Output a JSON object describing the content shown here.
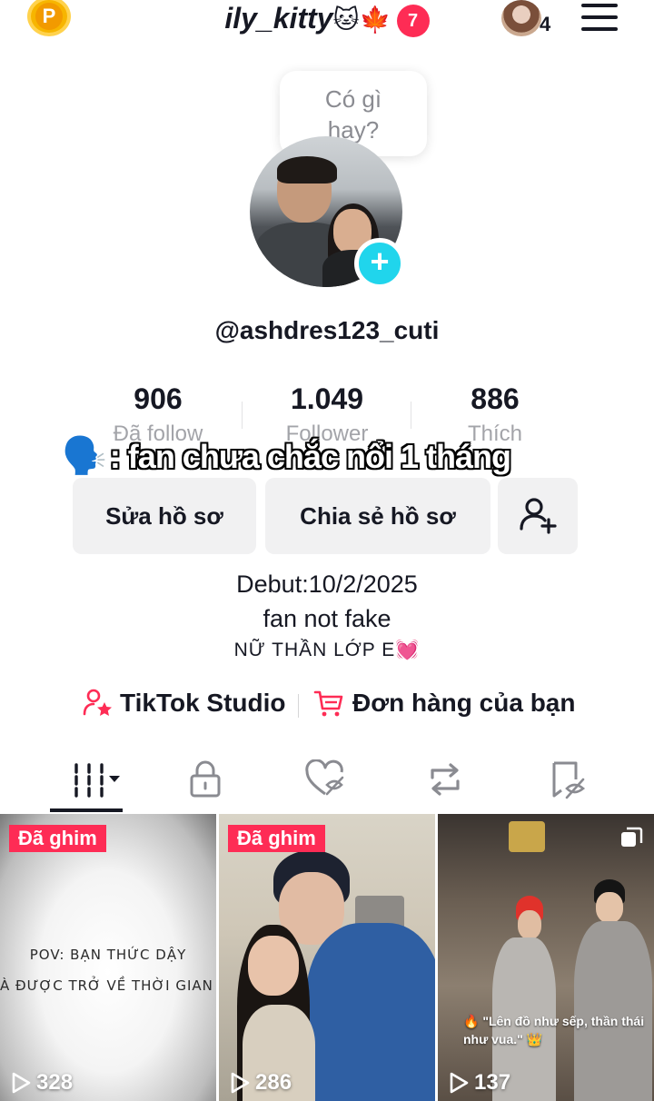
{
  "header": {
    "coin_letter": "P",
    "title": "ily_kitty",
    "title_emojis": "🐱🍁",
    "notification_count": "7",
    "account_switch_count": "4"
  },
  "profile": {
    "bubble_text_line1": "Có gì",
    "bubble_text_line2": "hay?",
    "handle": "@ashdres123_cuti",
    "stats": {
      "following_value": "906",
      "following_label": "Đã follow",
      "followers_value": "1.049",
      "followers_label": "Follower",
      "likes_value": "886",
      "likes_label": "Thích"
    },
    "overlay_caption": ": fan chưa chắc nổi 1 tháng",
    "overlay_emoji": "🗣️"
  },
  "actions": {
    "edit_profile": "Sửa hồ sơ",
    "share_profile": "Chia sẻ hồ sơ"
  },
  "bio": {
    "line1": "Debut:10/2/2025",
    "line2": "fan not fake",
    "line3": "NỮ THẦN LỚP E",
    "line3_emoji": "💓"
  },
  "links": {
    "studio": "TikTok Studio",
    "orders": "Đơn hàng của bạn"
  },
  "videos": [
    {
      "pinned_label": "Đã ghim",
      "text_line1": "POV: BẠN THỨC DẬY",
      "text_line2": "À ĐƯỢC TRỞ VỀ THỜI GIAN ĐÓ",
      "views": "328"
    },
    {
      "pinned_label": "Đã ghim",
      "views": "286"
    },
    {
      "caption": "🔥 \"Lên đồ như sếp, thần thái như vua.\" 👑",
      "views": "137"
    }
  ],
  "colors": {
    "accent": "#fe2c55",
    "plus": "#20d5ec",
    "button_bg": "#f1f1f2",
    "coin": "#f7b500"
  }
}
